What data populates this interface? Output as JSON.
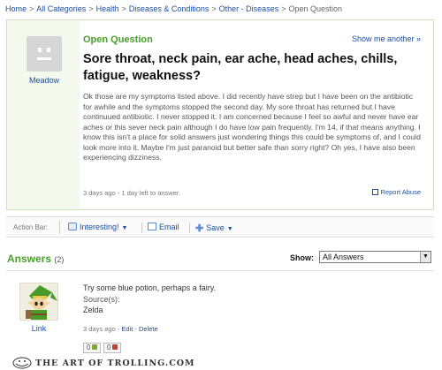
{
  "breadcrumb": {
    "items": [
      "Home",
      "All Categories",
      "Health",
      "Diseases & Conditions",
      "Other - Diseases"
    ],
    "current": "Open Question"
  },
  "question": {
    "asker": "Meadow",
    "status": "Open Question",
    "show_more": "Show me another »",
    "title": "Sore throat, neck pain, ear ache, head aches, chills, fatigue, weakness?",
    "body": "Ok those are my symptoms listed above. I did recently have strep but I have been on the antibiotic for awhile and the symptoms stopped the second day. My sore throat has returned but I have continuued antibiotic. I never stopped it. I am concerned because I feel so awful and never have ear aches or this sever neck pain although I do have low pain frequently. I'm 14, if that means anything. I know this isn't a place for solid answers just wondering things this could be symptoms of, and I could look more into it. Maybe I'm just paranoid but better safe than sorry right? Oh yes, I have also been experiencing dizziness.",
    "meta": "3 days ago - 1 day left to answer.",
    "report": "Report Abuse"
  },
  "action_bar": {
    "label": "Action Bar:",
    "interesting": "Interesting!",
    "email": "Email",
    "save": "Save"
  },
  "answers": {
    "heading": "Answers",
    "count": "(2)",
    "show_label": "Show:",
    "show_value": "All Answers",
    "items": [
      {
        "author": "Link",
        "text": "Try some blue potion, perhaps a fairy.",
        "source_label": "Source(s):",
        "source": "Zelda",
        "meta": "3 days ago - ",
        "edit": "Edit",
        "meta_sep": " - ",
        "delete": "Delete",
        "votes_up": "0",
        "votes_down": "0"
      }
    ]
  },
  "watermark": "THE ART OF TROLLING.COM",
  "colors": {
    "accent_green": "#49a02b",
    "link_blue": "#1a4fa3",
    "panel_bg": "#f4f9ee"
  }
}
